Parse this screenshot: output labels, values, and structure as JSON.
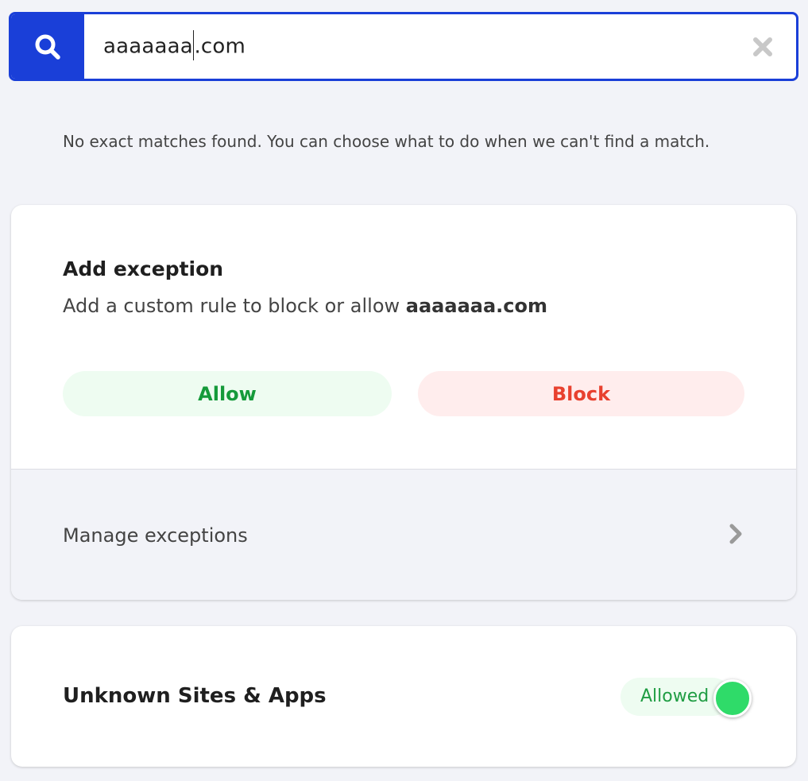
{
  "search": {
    "value_before_caret": "aaaaaaa",
    "value_after_caret": ".com",
    "icon": "search-icon",
    "clear_icon": "close-icon"
  },
  "message": "No exact matches found. You can choose what to do when we can't find a match.",
  "exception_card": {
    "title": "Add exception",
    "description_prefix": "Add a custom rule to block or allow ",
    "domain": "aaaaaaa.com",
    "allow_label": "Allow",
    "block_label": "Block",
    "manage_label": "Manage exceptions",
    "manage_icon": "chevron-right-icon"
  },
  "unknown_card": {
    "title": "Unknown Sites & Apps",
    "toggle_label": "Allowed",
    "toggle_on": true
  },
  "colors": {
    "accent": "#1a3fd8",
    "allow_text": "#159a3a",
    "allow_bg": "#eefcf1",
    "block_text": "#e8412f",
    "block_bg": "#ffeded",
    "toggle_knob": "#2fdb69"
  }
}
